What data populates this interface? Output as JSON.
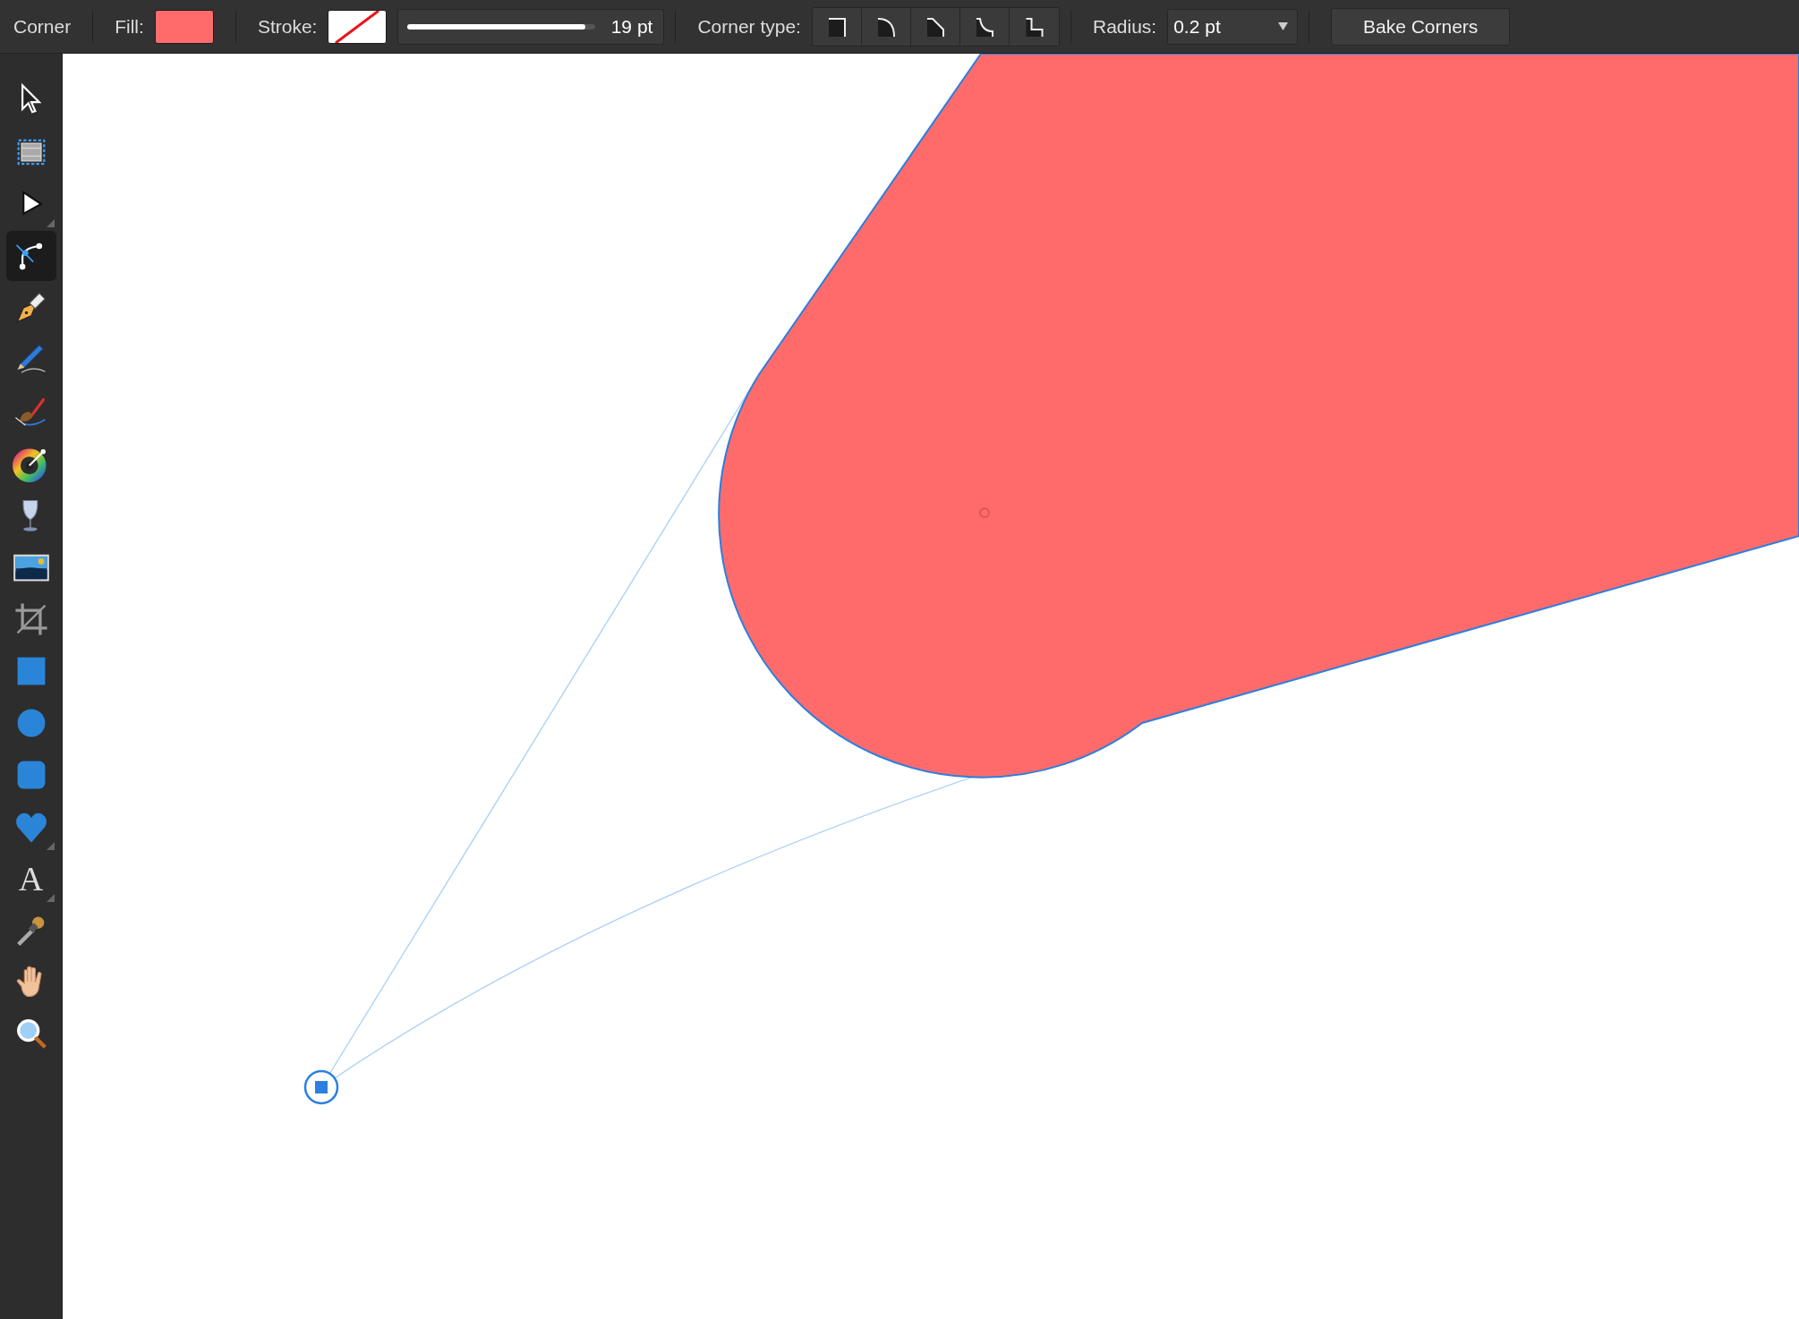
{
  "context_toolbar": {
    "mode_label": "Corner",
    "fill": {
      "label": "Fill:",
      "color": "#ff6b6b"
    },
    "stroke": {
      "label": "Stroke:",
      "level": 0.95,
      "width_reading": "19 pt"
    },
    "corner_type": {
      "label": "Corner type:",
      "options": [
        {
          "kind": "none"
        },
        {
          "kind": "rounded"
        },
        {
          "kind": "straight"
        },
        {
          "kind": "concave"
        },
        {
          "kind": "inset"
        }
      ]
    },
    "radius": {
      "label": "Radius:",
      "value": "0.2 pt"
    },
    "bake_button": "Bake Corners"
  },
  "tools": [
    {
      "kind": "move",
      "selected": false,
      "flyout": false
    },
    {
      "kind": "artboard",
      "selected": false,
      "flyout": false
    },
    {
      "kind": "node",
      "selected": false,
      "flyout": true
    },
    {
      "kind": "corner",
      "selected": true,
      "flyout": false
    },
    {
      "kind": "pen",
      "selected": false,
      "flyout": false
    },
    {
      "kind": "pencil",
      "selected": false,
      "flyout": false
    },
    {
      "kind": "brush",
      "selected": false,
      "flyout": false
    },
    {
      "kind": "fill",
      "selected": false,
      "flyout": false
    },
    {
      "kind": "transparency",
      "selected": false,
      "flyout": false
    },
    {
      "kind": "image",
      "selected": false,
      "flyout": false
    },
    {
      "kind": "crop",
      "selected": false,
      "flyout": false
    },
    {
      "kind": "rectangle",
      "selected": false,
      "flyout": false
    },
    {
      "kind": "ellipse",
      "selected": false,
      "flyout": false
    },
    {
      "kind": "rounded-rectangle",
      "selected": false,
      "flyout": false
    },
    {
      "kind": "heart",
      "selected": false,
      "flyout": true
    },
    {
      "kind": "text",
      "glyph": "A",
      "selected": false,
      "flyout": true
    },
    {
      "kind": "eyedropper",
      "selected": false,
      "flyout": false
    },
    {
      "kind": "hand",
      "selected": false,
      "flyout": false
    },
    {
      "kind": "zoom",
      "selected": false,
      "flyout": false
    }
  ]
}
